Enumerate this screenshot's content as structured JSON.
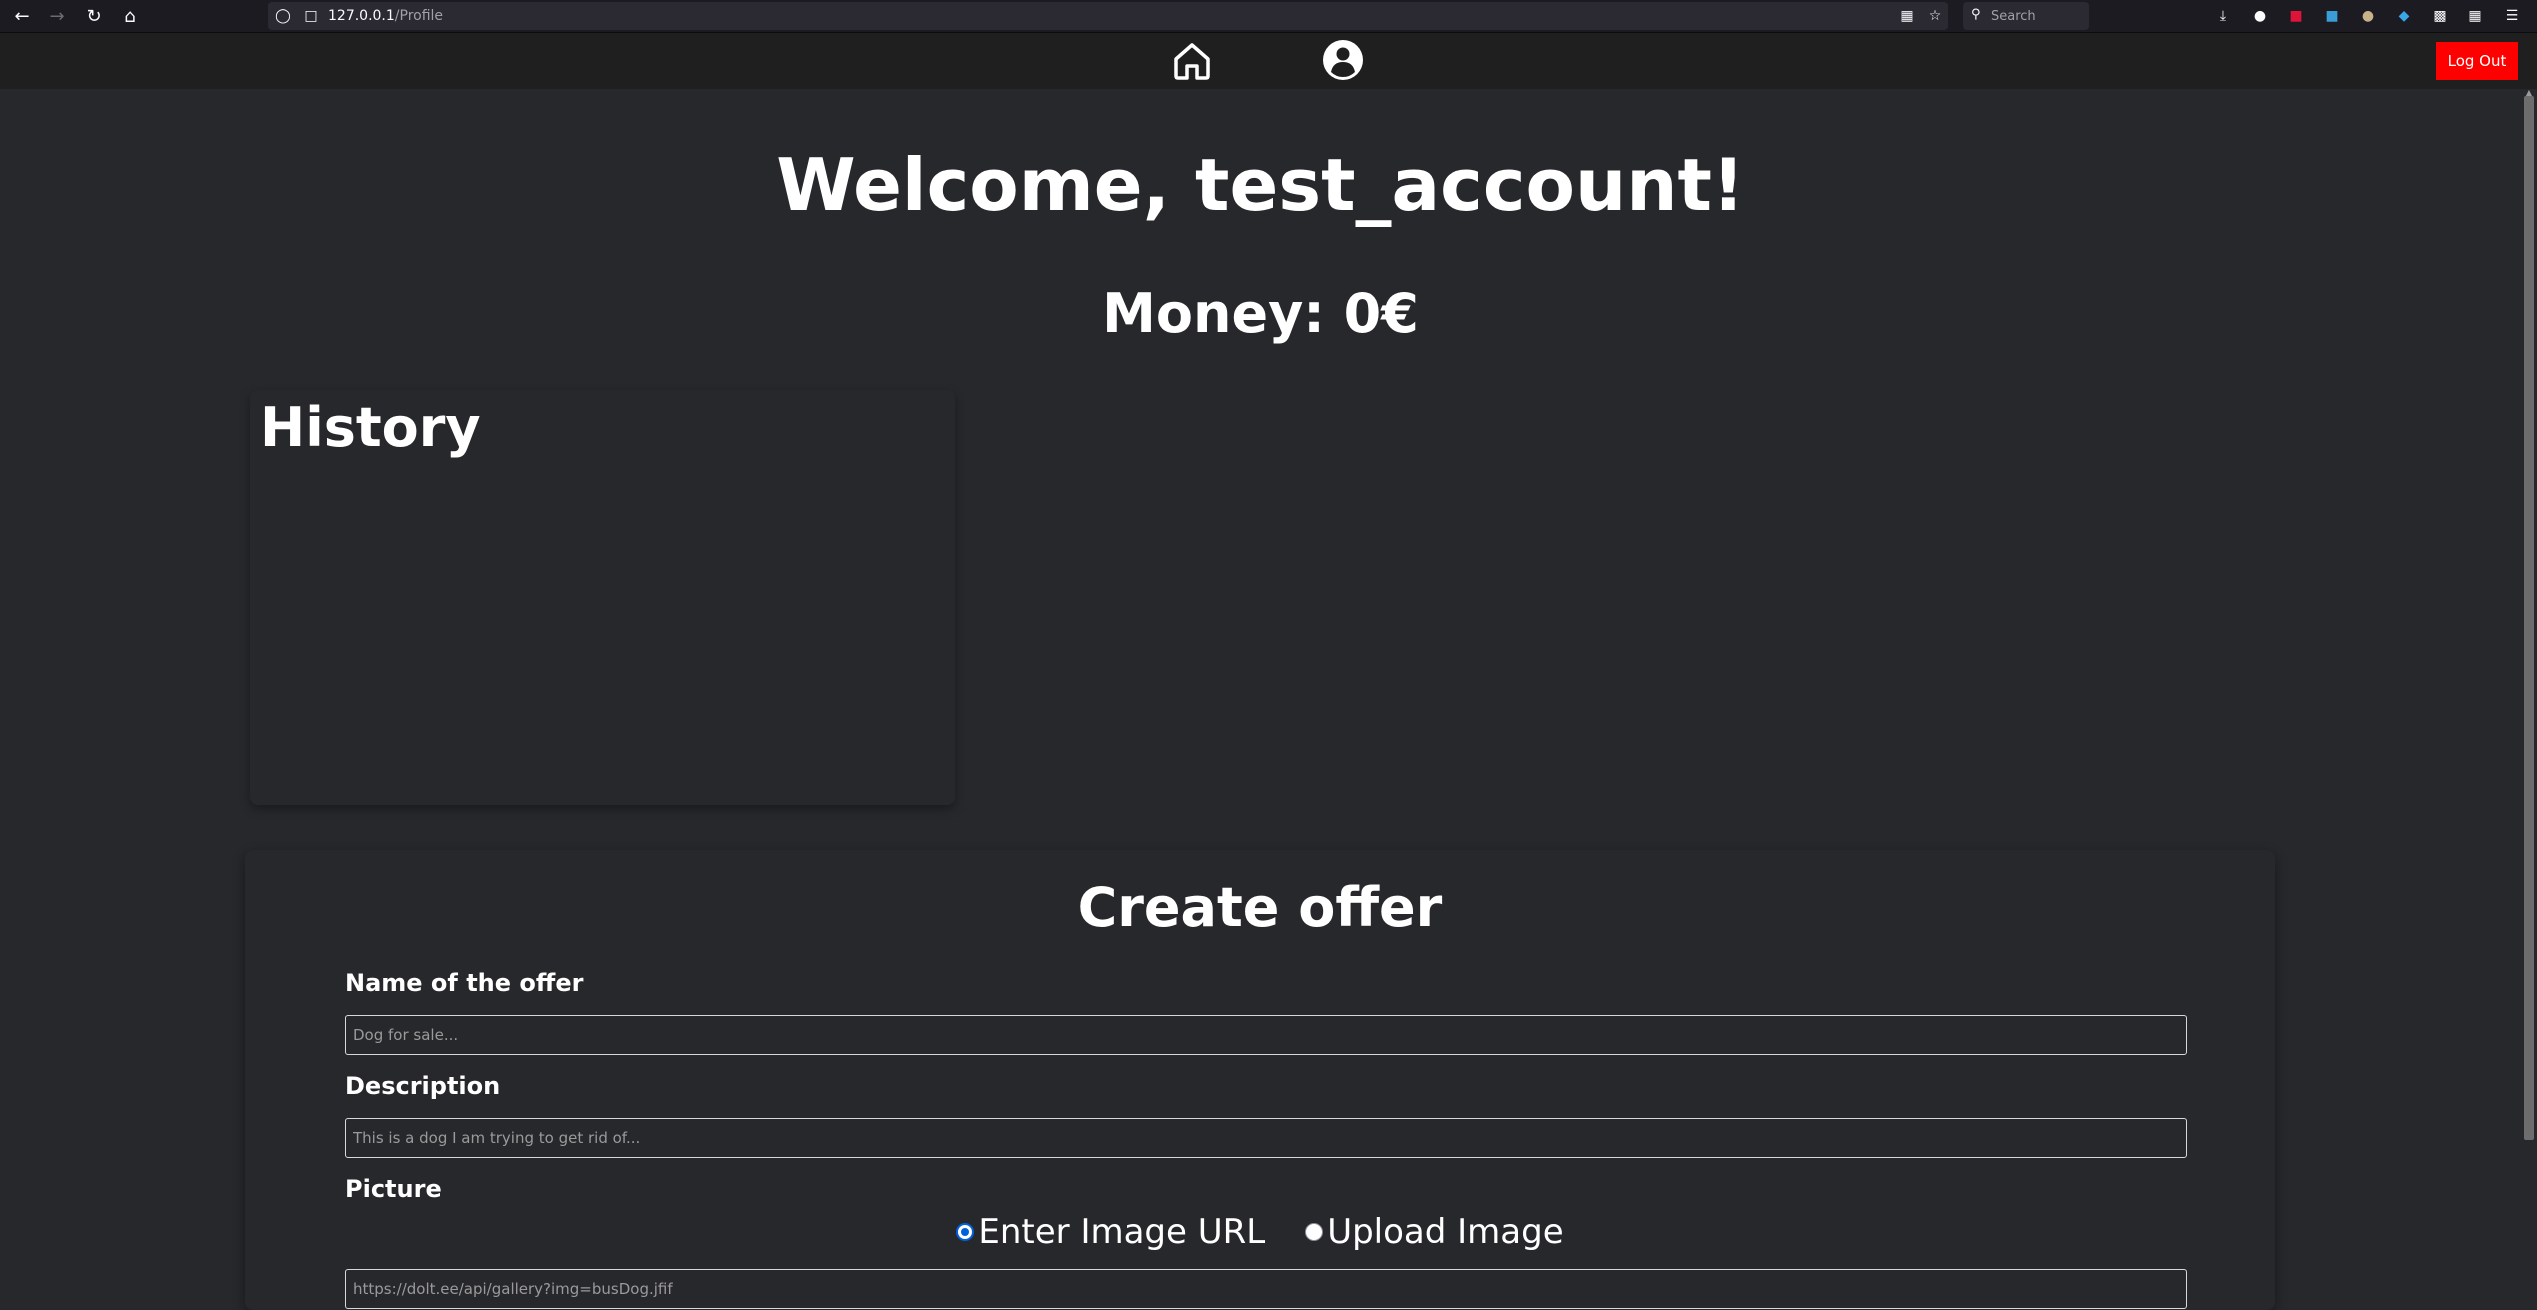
{
  "browser": {
    "url_host": "127.0.0.1",
    "url_path": "/Profile",
    "search_placeholder": "Search"
  },
  "nav": {
    "logout_label": "Log Out"
  },
  "profile": {
    "welcome": "Welcome, test_account!",
    "money": "Money: 0€"
  },
  "history": {
    "title": "History"
  },
  "offer": {
    "title": "Create offer",
    "name_label": "Name of the offer",
    "name_placeholder": "Dog for sale...",
    "description_label": "Description",
    "description_placeholder": "This is a dog I am trying to get rid of...",
    "picture_label": "Picture",
    "radio_url_label": "Enter Image URL",
    "radio_upload_label": "Upload Image",
    "image_url_placeholder": "https://dolt.ee/api/gallery?img=busDog.jfif"
  },
  "colors": {
    "page_bg": "#27282c",
    "navbar_bg": "#1f1f20",
    "logout_bg": "#ff0000",
    "radio_accent": "#0060df"
  }
}
